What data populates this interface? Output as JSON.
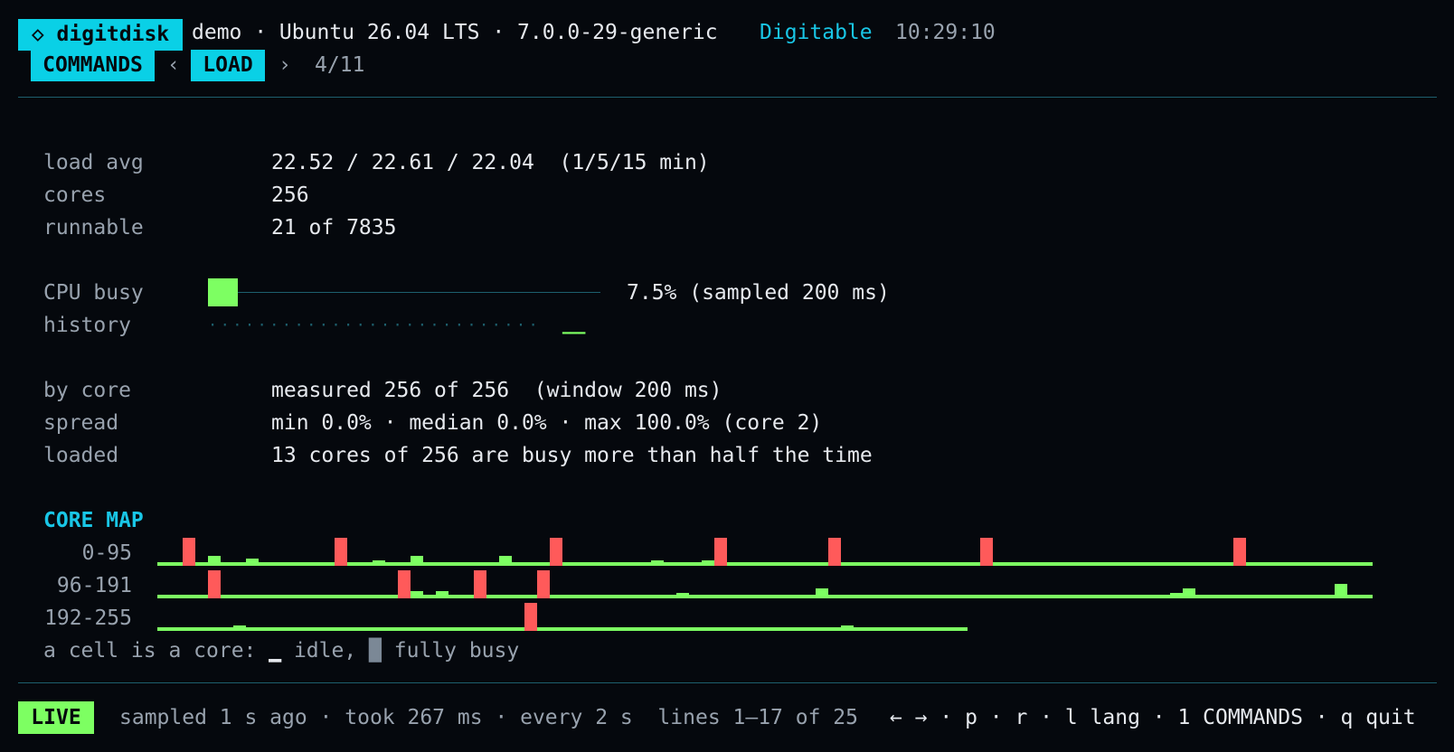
{
  "header": {
    "brand": "◇ digitdisk",
    "host_info": "demo · Ubuntu 26.04 LTS · 7.0.0-29-generic",
    "app_name": "Digitable",
    "clock": "10:29:10"
  },
  "tabs": {
    "commands_label": "COMMANDS",
    "prev_arrow": "‹",
    "active_label": "LOAD",
    "next_arrow": "›",
    "position": "4/11"
  },
  "stats": {
    "load_avg_label": "load avg",
    "load_avg_value": "22.52 / 22.61 / 22.04  (1/5/15 min)",
    "cores_label": "cores",
    "cores_value": "256",
    "runnable_label": "runnable",
    "runnable_value": "21 of 7835"
  },
  "cpu": {
    "busy_label": "CPU busy",
    "busy_fraction": 0.075,
    "busy_value": "7.5% (sampled 200 ms)",
    "history_label": "history",
    "history_dots": "···························",
    "history_recent_busy": "▁▁▁"
  },
  "by_core": {
    "by_core_label": "by core",
    "by_core_value": "measured 256 of 256  (window 200 ms)",
    "spread_label": "spread",
    "spread_value": "min 0.0% · median 0.0% · max 100.0% (core 2)",
    "loaded_label": "loaded",
    "loaded_value": "13 cores of 256 are busy more than half the time"
  },
  "core_map": {
    "title": "CORE MAP",
    "rows": [
      {
        "label": "0-95",
        "count": 96,
        "busy": {
          "2": 1.0,
          "4": 0.35,
          "7": 0.25,
          "14": 1.0,
          "17": 0.2,
          "20": 0.35,
          "27": 0.35,
          "31": 1.0,
          "39": 0.2,
          "43": 0.2,
          "44": 1.0,
          "53": 1.0,
          "65": 1.0,
          "85": 1.0
        }
      },
      {
        "label": "96-191",
        "count": 96,
        "busy": {
          "4": 1.0,
          "19": 1.0,
          "20": 0.25,
          "22": 0.25,
          "25": 1.0,
          "30": 1.0,
          "41": 0.2,
          "52": 0.35,
          "80": 0.2,
          "81": 0.35,
          "93": 0.5
        }
      },
      {
        "label": "192-255",
        "count": 64,
        "busy": {
          "6": 0.2,
          "29": 1.0,
          "54": 0.2
        }
      }
    ],
    "legend_prefix": "a cell is a core: ",
    "legend_idle_glyph": "▁",
    "legend_idle_text": " idle, ",
    "legend_busy_glyph": "█",
    "legend_busy_text": " fully busy",
    "idle_color": "#7dff62",
    "busy_color": "#ff5a5a"
  },
  "footer": {
    "status": "LIVE",
    "info": "sampled 1 s ago · took 267 ms · every 2 s  lines 1–17 of 25",
    "keys": "← → · p · r · l lang · 1 COMMANDS · q quit"
  },
  "colors": {
    "accent": "#0ad0e6",
    "live": "#7dff62",
    "busy": "#ff5a5a",
    "divider": "#1d5f6d"
  }
}
